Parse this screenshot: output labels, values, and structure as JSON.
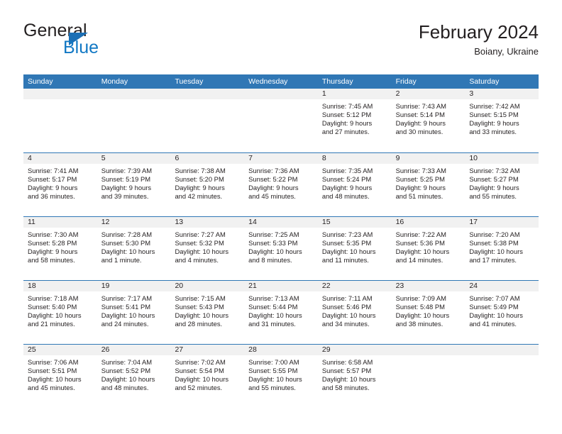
{
  "brand": {
    "name_part1": "General",
    "name_part2": "Blue",
    "flag_icon": "triangle-flag-icon",
    "accent_color": "#1b6fb5"
  },
  "header": {
    "title": "February 2024",
    "location": "Boiany, Ukraine"
  },
  "theme": {
    "header_blue": "#3077b5",
    "daynum_band": "#f1f1f1",
    "text": "#231f20"
  },
  "weekday_headers": [
    "Sunday",
    "Monday",
    "Tuesday",
    "Wednesday",
    "Thursday",
    "Friday",
    "Saturday"
  ],
  "weeks": [
    [
      {
        "day": "",
        "sunrise": "",
        "sunset": "",
        "daylight1": "",
        "daylight2": ""
      },
      {
        "day": "",
        "sunrise": "",
        "sunset": "",
        "daylight1": "",
        "daylight2": ""
      },
      {
        "day": "",
        "sunrise": "",
        "sunset": "",
        "daylight1": "",
        "daylight2": ""
      },
      {
        "day": "",
        "sunrise": "",
        "sunset": "",
        "daylight1": "",
        "daylight2": ""
      },
      {
        "day": "1",
        "sunrise": "Sunrise: 7:45 AM",
        "sunset": "Sunset: 5:12 PM",
        "daylight1": "Daylight: 9 hours",
        "daylight2": "and 27 minutes."
      },
      {
        "day": "2",
        "sunrise": "Sunrise: 7:43 AM",
        "sunset": "Sunset: 5:14 PM",
        "daylight1": "Daylight: 9 hours",
        "daylight2": "and 30 minutes."
      },
      {
        "day": "3",
        "sunrise": "Sunrise: 7:42 AM",
        "sunset": "Sunset: 5:15 PM",
        "daylight1": "Daylight: 9 hours",
        "daylight2": "and 33 minutes."
      }
    ],
    [
      {
        "day": "4",
        "sunrise": "Sunrise: 7:41 AM",
        "sunset": "Sunset: 5:17 PM",
        "daylight1": "Daylight: 9 hours",
        "daylight2": "and 36 minutes."
      },
      {
        "day": "5",
        "sunrise": "Sunrise: 7:39 AM",
        "sunset": "Sunset: 5:19 PM",
        "daylight1": "Daylight: 9 hours",
        "daylight2": "and 39 minutes."
      },
      {
        "day": "6",
        "sunrise": "Sunrise: 7:38 AM",
        "sunset": "Sunset: 5:20 PM",
        "daylight1": "Daylight: 9 hours",
        "daylight2": "and 42 minutes."
      },
      {
        "day": "7",
        "sunrise": "Sunrise: 7:36 AM",
        "sunset": "Sunset: 5:22 PM",
        "daylight1": "Daylight: 9 hours",
        "daylight2": "and 45 minutes."
      },
      {
        "day": "8",
        "sunrise": "Sunrise: 7:35 AM",
        "sunset": "Sunset: 5:24 PM",
        "daylight1": "Daylight: 9 hours",
        "daylight2": "and 48 minutes."
      },
      {
        "day": "9",
        "sunrise": "Sunrise: 7:33 AM",
        "sunset": "Sunset: 5:25 PM",
        "daylight1": "Daylight: 9 hours",
        "daylight2": "and 51 minutes."
      },
      {
        "day": "10",
        "sunrise": "Sunrise: 7:32 AM",
        "sunset": "Sunset: 5:27 PM",
        "daylight1": "Daylight: 9 hours",
        "daylight2": "and 55 minutes."
      }
    ],
    [
      {
        "day": "11",
        "sunrise": "Sunrise: 7:30 AM",
        "sunset": "Sunset: 5:28 PM",
        "daylight1": "Daylight: 9 hours",
        "daylight2": "and 58 minutes."
      },
      {
        "day": "12",
        "sunrise": "Sunrise: 7:28 AM",
        "sunset": "Sunset: 5:30 PM",
        "daylight1": "Daylight: 10 hours",
        "daylight2": "and 1 minute."
      },
      {
        "day": "13",
        "sunrise": "Sunrise: 7:27 AM",
        "sunset": "Sunset: 5:32 PM",
        "daylight1": "Daylight: 10 hours",
        "daylight2": "and 4 minutes."
      },
      {
        "day": "14",
        "sunrise": "Sunrise: 7:25 AM",
        "sunset": "Sunset: 5:33 PM",
        "daylight1": "Daylight: 10 hours",
        "daylight2": "and 8 minutes."
      },
      {
        "day": "15",
        "sunrise": "Sunrise: 7:23 AM",
        "sunset": "Sunset: 5:35 PM",
        "daylight1": "Daylight: 10 hours",
        "daylight2": "and 11 minutes."
      },
      {
        "day": "16",
        "sunrise": "Sunrise: 7:22 AM",
        "sunset": "Sunset: 5:36 PM",
        "daylight1": "Daylight: 10 hours",
        "daylight2": "and 14 minutes."
      },
      {
        "day": "17",
        "sunrise": "Sunrise: 7:20 AM",
        "sunset": "Sunset: 5:38 PM",
        "daylight1": "Daylight: 10 hours",
        "daylight2": "and 17 minutes."
      }
    ],
    [
      {
        "day": "18",
        "sunrise": "Sunrise: 7:18 AM",
        "sunset": "Sunset: 5:40 PM",
        "daylight1": "Daylight: 10 hours",
        "daylight2": "and 21 minutes."
      },
      {
        "day": "19",
        "sunrise": "Sunrise: 7:17 AM",
        "sunset": "Sunset: 5:41 PM",
        "daylight1": "Daylight: 10 hours",
        "daylight2": "and 24 minutes."
      },
      {
        "day": "20",
        "sunrise": "Sunrise: 7:15 AM",
        "sunset": "Sunset: 5:43 PM",
        "daylight1": "Daylight: 10 hours",
        "daylight2": "and 28 minutes."
      },
      {
        "day": "21",
        "sunrise": "Sunrise: 7:13 AM",
        "sunset": "Sunset: 5:44 PM",
        "daylight1": "Daylight: 10 hours",
        "daylight2": "and 31 minutes."
      },
      {
        "day": "22",
        "sunrise": "Sunrise: 7:11 AM",
        "sunset": "Sunset: 5:46 PM",
        "daylight1": "Daylight: 10 hours",
        "daylight2": "and 34 minutes."
      },
      {
        "day": "23",
        "sunrise": "Sunrise: 7:09 AM",
        "sunset": "Sunset: 5:48 PM",
        "daylight1": "Daylight: 10 hours",
        "daylight2": "and 38 minutes."
      },
      {
        "day": "24",
        "sunrise": "Sunrise: 7:07 AM",
        "sunset": "Sunset: 5:49 PM",
        "daylight1": "Daylight: 10 hours",
        "daylight2": "and 41 minutes."
      }
    ],
    [
      {
        "day": "25",
        "sunrise": "Sunrise: 7:06 AM",
        "sunset": "Sunset: 5:51 PM",
        "daylight1": "Daylight: 10 hours",
        "daylight2": "and 45 minutes."
      },
      {
        "day": "26",
        "sunrise": "Sunrise: 7:04 AM",
        "sunset": "Sunset: 5:52 PM",
        "daylight1": "Daylight: 10 hours",
        "daylight2": "and 48 minutes."
      },
      {
        "day": "27",
        "sunrise": "Sunrise: 7:02 AM",
        "sunset": "Sunset: 5:54 PM",
        "daylight1": "Daylight: 10 hours",
        "daylight2": "and 52 minutes."
      },
      {
        "day": "28",
        "sunrise": "Sunrise: 7:00 AM",
        "sunset": "Sunset: 5:55 PM",
        "daylight1": "Daylight: 10 hours",
        "daylight2": "and 55 minutes."
      },
      {
        "day": "29",
        "sunrise": "Sunrise: 6:58 AM",
        "sunset": "Sunset: 5:57 PM",
        "daylight1": "Daylight: 10 hours",
        "daylight2": "and 58 minutes."
      },
      {
        "day": "",
        "sunrise": "",
        "sunset": "",
        "daylight1": "",
        "daylight2": ""
      },
      {
        "day": "",
        "sunrise": "",
        "sunset": "",
        "daylight1": "",
        "daylight2": ""
      }
    ]
  ]
}
